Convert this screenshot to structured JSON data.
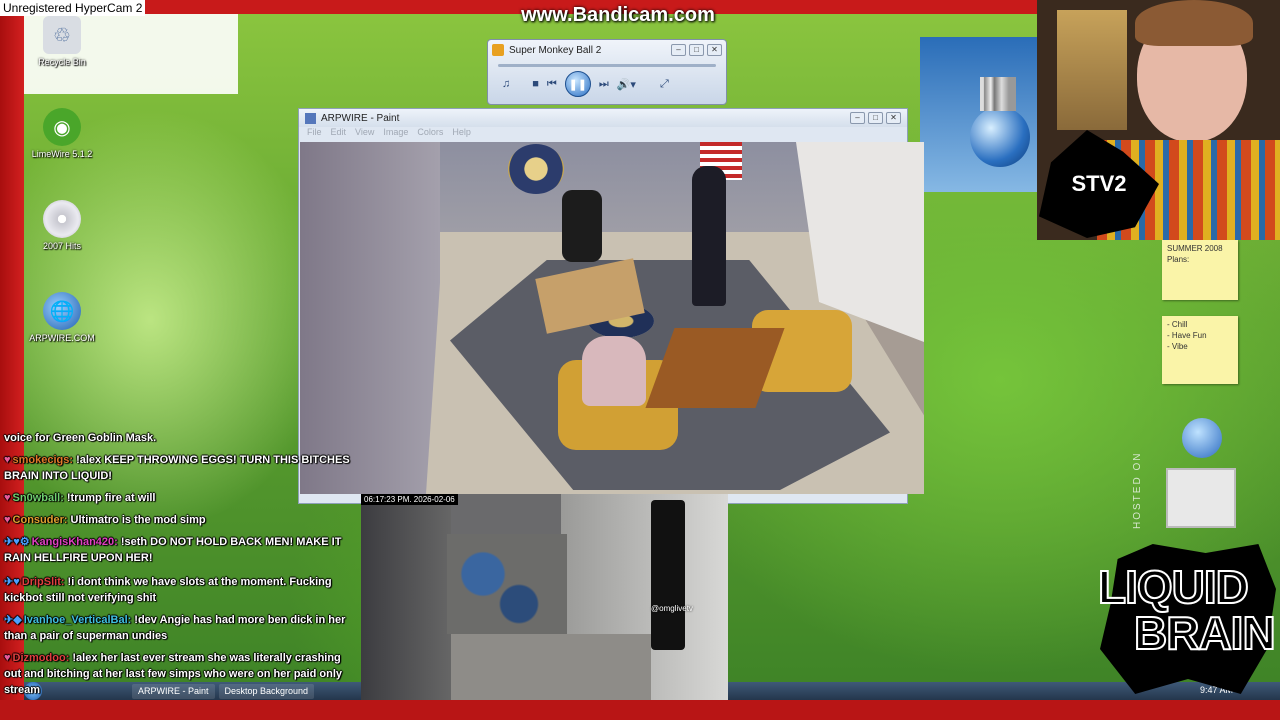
{
  "watermark": "www.Bandicam.com",
  "desktop_icons": [
    {
      "label": "Recycle Bin",
      "icon": "recycle-bin-icon"
    },
    {
      "label": "LimeWire 5.1.2",
      "icon": "limewire-icon"
    },
    {
      "label": "2007 Hits",
      "icon": "cd-icon"
    },
    {
      "label": "ARPWIRE.COM",
      "icon": "globe-icon"
    }
  ],
  "media_player": {
    "title": "Super Monkey Ball 2"
  },
  "paint": {
    "title": "ARPWIRE - Paint",
    "menu": [
      "File",
      "Edit",
      "View",
      "Image",
      "Colors",
      "Help"
    ]
  },
  "webcam": {
    "label": "Unregistered HyperCam 2",
    "overlay": "STV2"
  },
  "sticky_note": {
    "title": "SUMMER 2008 Plans:",
    "items": [
      "- Chill",
      "- Have Fun",
      "- Vibe"
    ]
  },
  "street_cam": {
    "timestamp": "06:17:23 PM.  2026-02-06",
    "handle": "@omglivetv"
  },
  "chat": [
    {
      "user": "",
      "text": "voice for Green Goblin Mask.",
      "color": "#ffffff"
    },
    {
      "user": "smokecigs:",
      "text": "!alex KEEP THROWING EGGS! TURN THIS BITCHES BRAIN INTO LIQUID!",
      "color": "#e07a2a"
    },
    {
      "user": "Sn0wball:",
      "text": "!trump fire at will",
      "color": "#6fd06f"
    },
    {
      "user": "Consuder:",
      "text": "Ultimatro is the mod simp",
      "color": "#e0a030"
    },
    {
      "user": "KangisKhan420:",
      "text": "!seth DO NOT HOLD BACK MEN! MAKE IT RAIN HELLFIRE UPON HER!",
      "color": "#e040c0"
    },
    {
      "user": "DripSlit:",
      "text": "!i dont think we have slots at the moment. Fucking kickbot still not verifying shit",
      "color": "#e04040"
    },
    {
      "user": "Ivanhoe_VerticalBal:",
      "text": "!dev Angie has had more ben dick in her than a pair of superman undies",
      "color": "#40c0e0"
    },
    {
      "user": "Dizmodoo:",
      "text": "!alex her last ever stream she was literally crashing out and bitching at her last few simps who were on her paid only stream",
      "color": "#e04040"
    }
  ],
  "taskbar": {
    "items": [
      "ARPWIRE - Paint",
      "Desktop Background"
    ],
    "clock": "9:47 AM"
  },
  "logo": {
    "line1": "LIQUID",
    "line2": "BRAIN"
  },
  "hosted_on": "HOSTED ON"
}
